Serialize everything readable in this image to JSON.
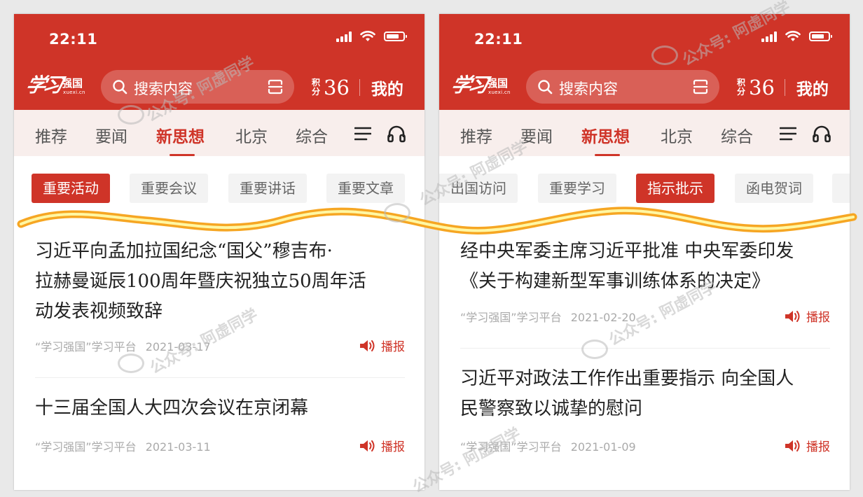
{
  "colors": {
    "brand_red": "#cf3428",
    "chip_bg": "#f3f3f3",
    "nav_bg": "#f8eeec",
    "wave_orange": "#f6a623",
    "wave_yellow": "#fff7a3"
  },
  "left": {
    "status": {
      "time": "22:11"
    },
    "header": {
      "logo_main": "学习",
      "logo_name": "强国",
      "logo_url": "xuexi.cn",
      "search_placeholder": "搜索内容",
      "points_label": "积分",
      "points_value": "36",
      "mine_label": "我的"
    },
    "nav": {
      "tabs": [
        {
          "label": "推荐"
        },
        {
          "label": "要闻"
        },
        {
          "label": "新思想"
        },
        {
          "label": "北京"
        },
        {
          "label": "综合"
        }
      ],
      "active_index": 2
    },
    "chips": [
      {
        "label": "重要活动",
        "active": true
      },
      {
        "label": "重要会议"
      },
      {
        "label": "重要讲话"
      },
      {
        "label": "重要文章"
      }
    ],
    "articles": [
      {
        "title_lines": [
          "习近平向孟加拉国纪念“国父”穆吉布·",
          "拉赫曼诞辰100周年暨庆祝独立50周年活",
          "动发表视频致辞"
        ],
        "source": "“学习强国”学习平台",
        "date": "2021-03-17",
        "play_label": "播报"
      },
      {
        "title_lines": [
          "十三届全国人大四次会议在京闭幕"
        ],
        "source": "“学习强国”学习平台",
        "date": "2021-03-11",
        "play_label": "播报"
      }
    ]
  },
  "right": {
    "status": {
      "time": "22:11"
    },
    "header": {
      "logo_main": "学习",
      "logo_name": "强国",
      "logo_url": "xuexi.cn",
      "search_placeholder": "搜索内容",
      "points_label": "积分",
      "points_value": "36",
      "mine_label": "我的"
    },
    "nav": {
      "tabs": [
        {
          "label": "推荐"
        },
        {
          "label": "要闻"
        },
        {
          "label": "新思想"
        },
        {
          "label": "北京"
        },
        {
          "label": "综合"
        }
      ],
      "active_index": 2
    },
    "chips": [
      {
        "label": "出国访问"
      },
      {
        "label": "重要学习"
      },
      {
        "label": "指示批示",
        "active": true
      },
      {
        "label": "函电贺词"
      }
    ],
    "articles": [
      {
        "title_lines": [
          "经中央军委主席习近平批准 中央军委印发",
          "《关于构建新型军事训练体系的决定》"
        ],
        "source": "“学习强国”学习平台",
        "date": "2021-02-20",
        "play_label": "播报"
      },
      {
        "title_lines": [
          "习近平对政法工作作出重要指示 向全国人",
          "民警察致以诚挚的慰问"
        ],
        "source": "“学习强国”学习平台",
        "date": "2021-01-09",
        "play_label": "播报"
      }
    ]
  },
  "watermark": {
    "text": "公众号: 阿虚同学"
  }
}
